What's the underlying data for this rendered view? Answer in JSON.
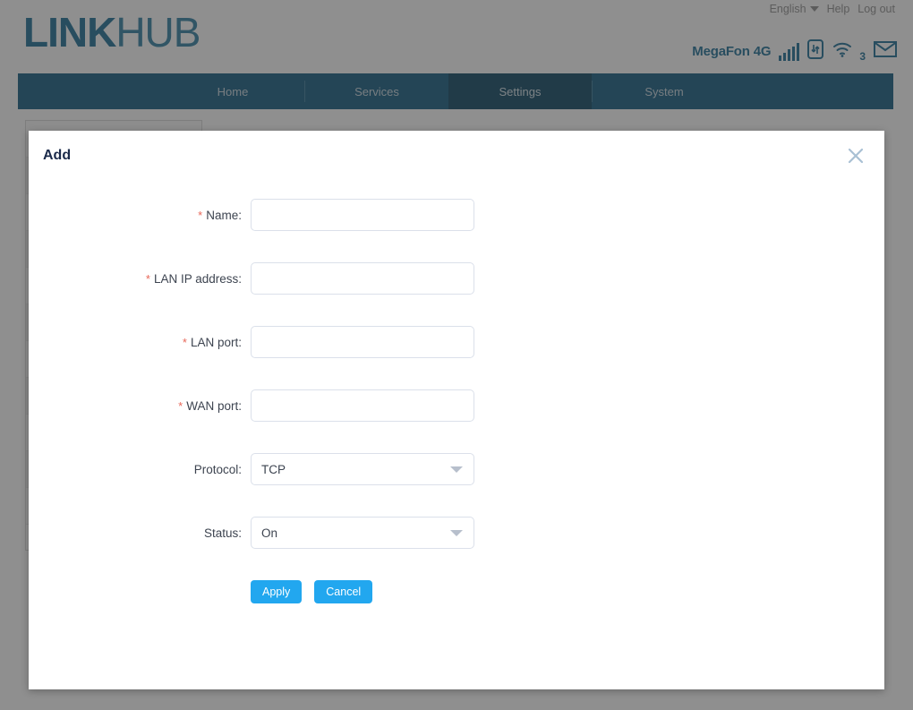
{
  "header": {
    "logo_strong": "LINK",
    "logo_thin": "HUB",
    "language": "English",
    "help_label": "Help",
    "logout_label": "Log out",
    "carrier": "MegaFon 4G",
    "wifi_clients": "3",
    "icons": [
      "signal-bars-icon",
      "sim-card-icon",
      "wifi-icon",
      "envelope-icon"
    ]
  },
  "nav": {
    "items": [
      {
        "label": "Home",
        "active": false
      },
      {
        "label": "Services",
        "active": false
      },
      {
        "label": "Settings",
        "active": true
      },
      {
        "label": "System",
        "active": false
      }
    ]
  },
  "modal": {
    "title": "Add",
    "close_label": "×",
    "fields": [
      {
        "label": "Name:",
        "required": true,
        "type": "text",
        "value": "",
        "placeholder": ""
      },
      {
        "label": "LAN IP address:",
        "required": true,
        "type": "text",
        "value": "",
        "placeholder": ""
      },
      {
        "label": "LAN port:",
        "required": true,
        "type": "text",
        "value": "",
        "placeholder": ""
      },
      {
        "label": "WAN port:",
        "required": true,
        "type": "text",
        "value": "",
        "placeholder": ""
      },
      {
        "label": "Protocol:",
        "required": false,
        "type": "select",
        "value": "TCP"
      },
      {
        "label": "Status:",
        "required": false,
        "type": "select",
        "value": "On"
      }
    ],
    "apply_label": "Apply",
    "cancel_label": "Cancel"
  },
  "background": {
    "add_button_glyph": "+"
  },
  "colors": {
    "brand_blue": "#1b6e96",
    "nav_blue": "#125b80",
    "nav_active": "#0c4562",
    "button_blue": "#22a7ef",
    "required_red": "#e8685a",
    "overlay": "rgba(51,51,51,0.55)"
  }
}
